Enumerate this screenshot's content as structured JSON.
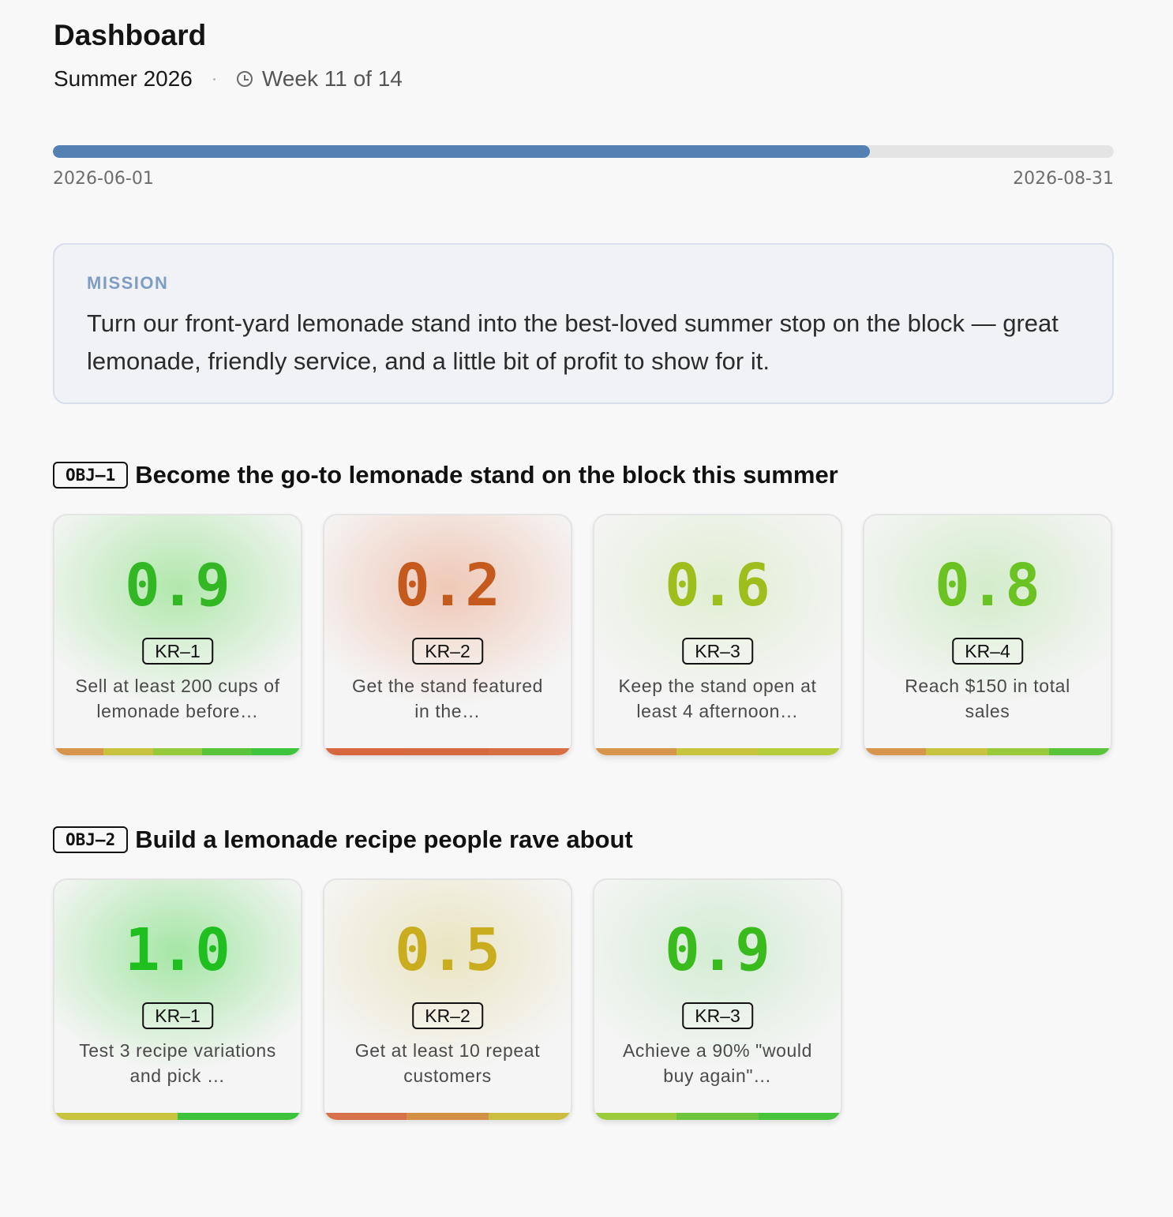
{
  "header": {
    "title": "Dashboard",
    "term": "Summer 2026",
    "week_icon": "clock-icon",
    "week_label": "Week 11 of 14"
  },
  "timeline": {
    "start_date": "2026-06-01",
    "end_date": "2026-08-31",
    "progress_fraction": 0.77,
    "color": "#5580b3"
  },
  "mission": {
    "label": "MISSION",
    "text": "Turn our front-yard lemonade stand into the best-loved summer stop on the block — great lemonade, friendly service, and a little bit of profit to show for it."
  },
  "objectives": [
    {
      "tag": "OBJ–1",
      "title": "Become the go-to lemonade stand on the block this summer",
      "key_results": [
        {
          "score": "0.9",
          "tag": "KR–1",
          "text": "Sell at least 200 cups of lemonade before…",
          "color": "#34b724",
          "glow": "rgba(120,220,110,0.55)",
          "scale": [
            "#d6954a",
            "#c8c33e",
            "#94ca3b",
            "#5ac43a",
            "#3dc33c"
          ]
        },
        {
          "score": "0.2",
          "tag": "KR–2",
          "text": "Get the stand featured in the…",
          "color": "#c45a1d",
          "glow": "rgba(235,170,140,0.6)",
          "scale": [
            "#d8663f",
            "#d5693f",
            "#d67044"
          ]
        },
        {
          "score": "0.6",
          "tag": "KR–3",
          "text": "Keep the stand open at least 4 afternoon…",
          "color": "#9cbf1e",
          "glow": "rgba(200,230,170,0.45)",
          "scale": [
            "#d6954a",
            "#c9c43e",
            "#b5cc3b"
          ]
        },
        {
          "score": "0.8",
          "tag": "KR–4",
          "text": "Reach $150 in total sales",
          "color": "#6ac323",
          "glow": "rgba(170,225,150,0.45)",
          "scale": [
            "#d6954a",
            "#c8c33e",
            "#98ca3b",
            "#5bc43a"
          ]
        }
      ]
    },
    {
      "tag": "OBJ–2",
      "title": "Build a lemonade recipe people rave about",
      "key_results": [
        {
          "score": "1.0",
          "tag": "KR–1",
          "text": "Test 3 recipe variations and pick …",
          "color": "#1fbf1f",
          "glow": "rgba(110,220,110,0.6)",
          "scale": [
            "#c9c43e",
            "#3dc33c"
          ]
        },
        {
          "score": "0.5",
          "tag": "KR–2",
          "text": "Get at least 10 repeat customers",
          "color": "#c9ad1e",
          "glow": "rgba(225,215,150,0.55)",
          "scale": [
            "#d6714a",
            "#d39145",
            "#cbbd3e"
          ]
        },
        {
          "score": "0.9",
          "tag": "KR–3",
          "text": "Achieve a 90% \"would buy again\"…",
          "color": "#39bb1e",
          "glow": "rgba(170,225,170,0.45)",
          "scale": [
            "#9ccc3b",
            "#6dc63b",
            "#45c43c"
          ]
        }
      ]
    }
  ]
}
